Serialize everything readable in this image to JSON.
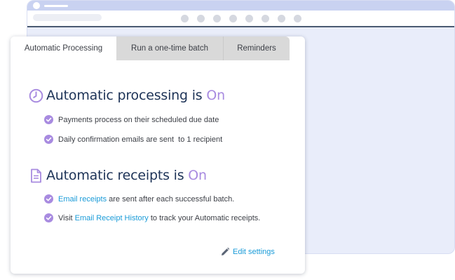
{
  "tabs": [
    {
      "label": "Automatic Processing",
      "active": true
    },
    {
      "label": "Run a one-time batch",
      "active": false
    },
    {
      "label": "Reminders",
      "active": false
    }
  ],
  "processing": {
    "heading": "Automatic processing is ",
    "state": "On",
    "icon": "clock-icon",
    "items": [
      "Payments process on their scheduled due date",
      "Daily confirmation emails are sent  to 1 recipient"
    ]
  },
  "receipts": {
    "heading": "Automatic receipts is ",
    "state": "On",
    "icon": "document-icon",
    "item1_link": "Email receipts",
    "item1_text": " are sent after each successful batch.",
    "item2_prefix": "Visit ",
    "item2_link": "Email Receipt History",
    "item2_text": " to track your Automatic receipts."
  },
  "edit_settings": "Edit settings",
  "colors": {
    "accent": "#a88be0",
    "heading": "#1d3357",
    "link": "#1a9bd8"
  }
}
